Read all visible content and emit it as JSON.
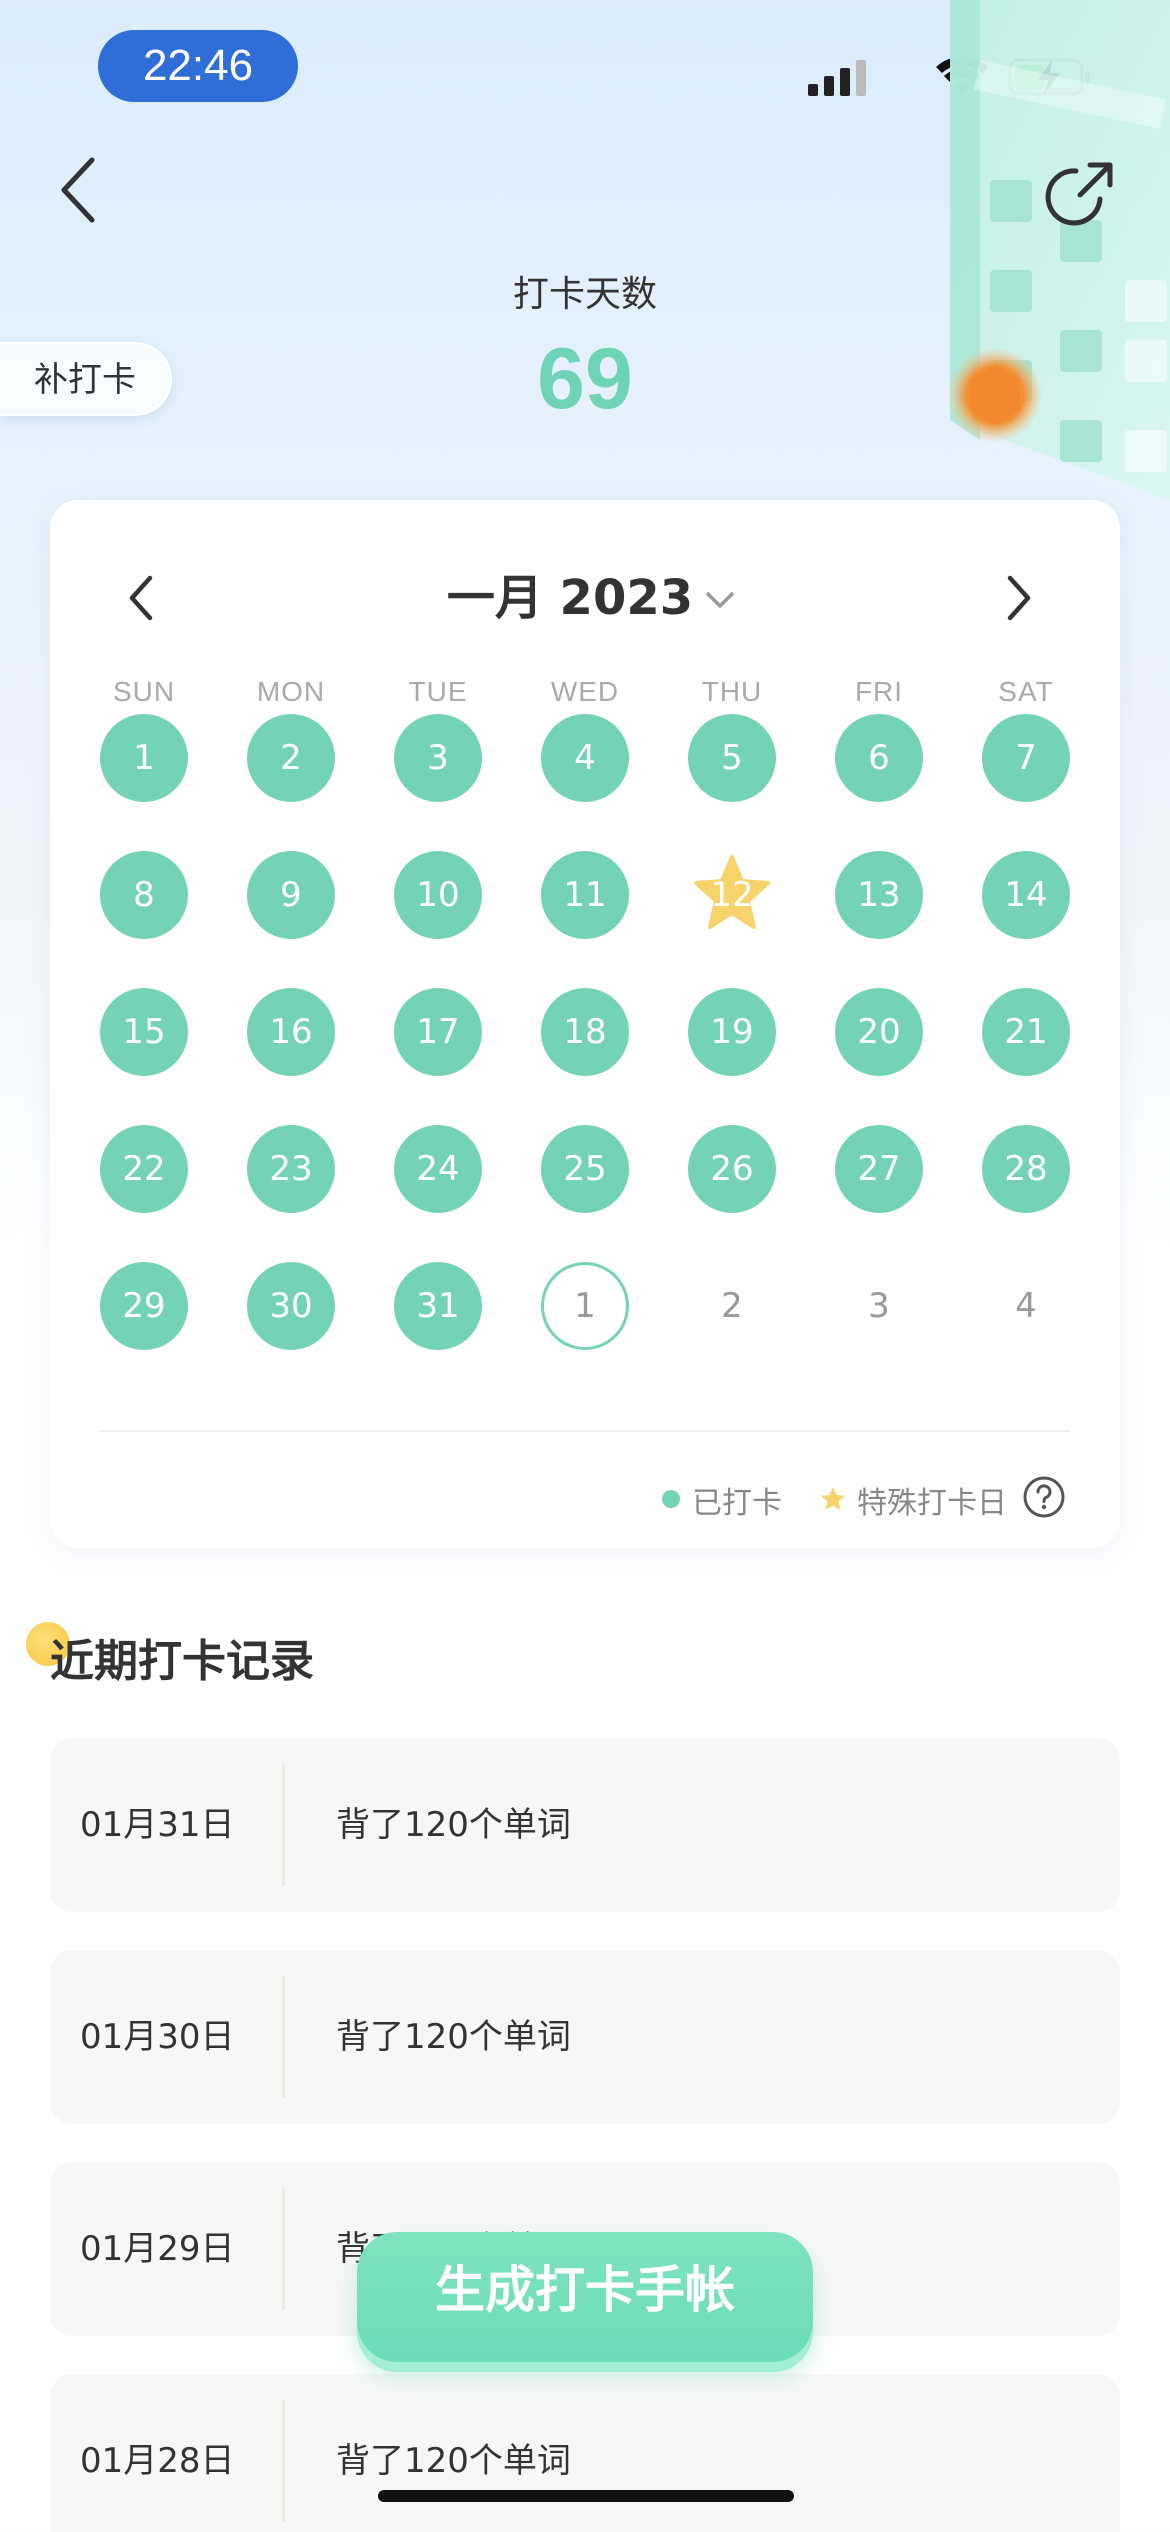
{
  "status_bar": {
    "time": "22:46"
  },
  "header": {
    "checkin_label": "打卡天数",
    "checkin_count": "69",
    "makeup_label": "补打卡"
  },
  "calendar": {
    "month_title": "一月 2023",
    "weekdays": [
      "SUN",
      "MON",
      "TUE",
      "WED",
      "THU",
      "FRI",
      "SAT"
    ],
    "days": [
      {
        "label": "1",
        "state": "done"
      },
      {
        "label": "2",
        "state": "done"
      },
      {
        "label": "3",
        "state": "done"
      },
      {
        "label": "4",
        "state": "done"
      },
      {
        "label": "5",
        "state": "done"
      },
      {
        "label": "6",
        "state": "done"
      },
      {
        "label": "7",
        "state": "done"
      },
      {
        "label": "8",
        "state": "done"
      },
      {
        "label": "9",
        "state": "done"
      },
      {
        "label": "10",
        "state": "done"
      },
      {
        "label": "11",
        "state": "done"
      },
      {
        "label": "12",
        "state": "special"
      },
      {
        "label": "13",
        "state": "done"
      },
      {
        "label": "14",
        "state": "done"
      },
      {
        "label": "15",
        "state": "done"
      },
      {
        "label": "16",
        "state": "done"
      },
      {
        "label": "17",
        "state": "done"
      },
      {
        "label": "18",
        "state": "done"
      },
      {
        "label": "19",
        "state": "done"
      },
      {
        "label": "20",
        "state": "done"
      },
      {
        "label": "21",
        "state": "done"
      },
      {
        "label": "22",
        "state": "done"
      },
      {
        "label": "23",
        "state": "done"
      },
      {
        "label": "24",
        "state": "done"
      },
      {
        "label": "25",
        "state": "done"
      },
      {
        "label": "26",
        "state": "done"
      },
      {
        "label": "27",
        "state": "done"
      },
      {
        "label": "28",
        "state": "done"
      },
      {
        "label": "29",
        "state": "done"
      },
      {
        "label": "30",
        "state": "done"
      },
      {
        "label": "31",
        "state": "done"
      },
      {
        "label": "1",
        "state": "today"
      },
      {
        "label": "2",
        "state": "next"
      },
      {
        "label": "3",
        "state": "next"
      },
      {
        "label": "4",
        "state": "next"
      }
    ],
    "legend_done": "已打卡",
    "legend_special": "特殊打卡日"
  },
  "records": {
    "title": "近期打卡记录",
    "items": [
      {
        "date": "01月31日",
        "text": "背了120个单词"
      },
      {
        "date": "01月30日",
        "text": "背了120个单词"
      },
      {
        "date": "01月29日",
        "text": "背了120个单词"
      },
      {
        "date": "01月28日",
        "text": "背了120个单词"
      }
    ]
  },
  "generate_button": "生成打卡手帐",
  "colors": {
    "accent": "#74d3b6",
    "star": "#f6d46b",
    "time_pill": "#2f6ed6"
  },
  "icons": {
    "back": "chevron-left-icon",
    "share": "share-icon",
    "prev": "chevron-left-icon",
    "next": "chevron-right-icon",
    "dropdown": "chevron-down-icon",
    "help": "help-icon",
    "star": "star-icon"
  }
}
